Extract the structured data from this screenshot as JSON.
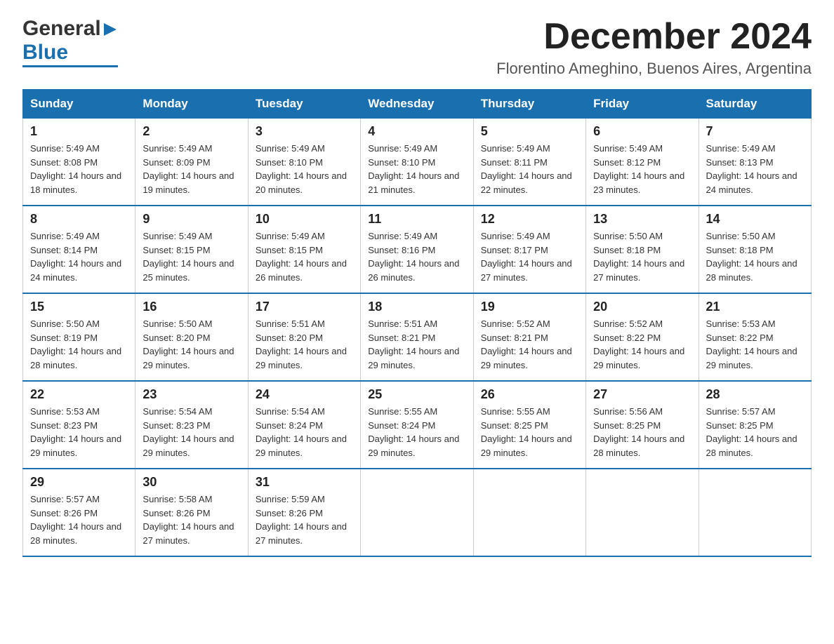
{
  "logo": {
    "general": "General",
    "blue": "Blue",
    "arrow_char": "▶"
  },
  "header": {
    "title": "December 2024",
    "subtitle": "Florentino Ameghino, Buenos Aires, Argentina"
  },
  "weekdays": [
    "Sunday",
    "Monday",
    "Tuesday",
    "Wednesday",
    "Thursday",
    "Friday",
    "Saturday"
  ],
  "weeks": [
    [
      {
        "day": "1",
        "sunrise": "Sunrise: 5:49 AM",
        "sunset": "Sunset: 8:08 PM",
        "daylight": "Daylight: 14 hours and 18 minutes."
      },
      {
        "day": "2",
        "sunrise": "Sunrise: 5:49 AM",
        "sunset": "Sunset: 8:09 PM",
        "daylight": "Daylight: 14 hours and 19 minutes."
      },
      {
        "day": "3",
        "sunrise": "Sunrise: 5:49 AM",
        "sunset": "Sunset: 8:10 PM",
        "daylight": "Daylight: 14 hours and 20 minutes."
      },
      {
        "day": "4",
        "sunrise": "Sunrise: 5:49 AM",
        "sunset": "Sunset: 8:10 PM",
        "daylight": "Daylight: 14 hours and 21 minutes."
      },
      {
        "day": "5",
        "sunrise": "Sunrise: 5:49 AM",
        "sunset": "Sunset: 8:11 PM",
        "daylight": "Daylight: 14 hours and 22 minutes."
      },
      {
        "day": "6",
        "sunrise": "Sunrise: 5:49 AM",
        "sunset": "Sunset: 8:12 PM",
        "daylight": "Daylight: 14 hours and 23 minutes."
      },
      {
        "day": "7",
        "sunrise": "Sunrise: 5:49 AM",
        "sunset": "Sunset: 8:13 PM",
        "daylight": "Daylight: 14 hours and 24 minutes."
      }
    ],
    [
      {
        "day": "8",
        "sunrise": "Sunrise: 5:49 AM",
        "sunset": "Sunset: 8:14 PM",
        "daylight": "Daylight: 14 hours and 24 minutes."
      },
      {
        "day": "9",
        "sunrise": "Sunrise: 5:49 AM",
        "sunset": "Sunset: 8:15 PM",
        "daylight": "Daylight: 14 hours and 25 minutes."
      },
      {
        "day": "10",
        "sunrise": "Sunrise: 5:49 AM",
        "sunset": "Sunset: 8:15 PM",
        "daylight": "Daylight: 14 hours and 26 minutes."
      },
      {
        "day": "11",
        "sunrise": "Sunrise: 5:49 AM",
        "sunset": "Sunset: 8:16 PM",
        "daylight": "Daylight: 14 hours and 26 minutes."
      },
      {
        "day": "12",
        "sunrise": "Sunrise: 5:49 AM",
        "sunset": "Sunset: 8:17 PM",
        "daylight": "Daylight: 14 hours and 27 minutes."
      },
      {
        "day": "13",
        "sunrise": "Sunrise: 5:50 AM",
        "sunset": "Sunset: 8:18 PM",
        "daylight": "Daylight: 14 hours and 27 minutes."
      },
      {
        "day": "14",
        "sunrise": "Sunrise: 5:50 AM",
        "sunset": "Sunset: 8:18 PM",
        "daylight": "Daylight: 14 hours and 28 minutes."
      }
    ],
    [
      {
        "day": "15",
        "sunrise": "Sunrise: 5:50 AM",
        "sunset": "Sunset: 8:19 PM",
        "daylight": "Daylight: 14 hours and 28 minutes."
      },
      {
        "day": "16",
        "sunrise": "Sunrise: 5:50 AM",
        "sunset": "Sunset: 8:20 PM",
        "daylight": "Daylight: 14 hours and 29 minutes."
      },
      {
        "day": "17",
        "sunrise": "Sunrise: 5:51 AM",
        "sunset": "Sunset: 8:20 PM",
        "daylight": "Daylight: 14 hours and 29 minutes."
      },
      {
        "day": "18",
        "sunrise": "Sunrise: 5:51 AM",
        "sunset": "Sunset: 8:21 PM",
        "daylight": "Daylight: 14 hours and 29 minutes."
      },
      {
        "day": "19",
        "sunrise": "Sunrise: 5:52 AM",
        "sunset": "Sunset: 8:21 PM",
        "daylight": "Daylight: 14 hours and 29 minutes."
      },
      {
        "day": "20",
        "sunrise": "Sunrise: 5:52 AM",
        "sunset": "Sunset: 8:22 PM",
        "daylight": "Daylight: 14 hours and 29 minutes."
      },
      {
        "day": "21",
        "sunrise": "Sunrise: 5:53 AM",
        "sunset": "Sunset: 8:22 PM",
        "daylight": "Daylight: 14 hours and 29 minutes."
      }
    ],
    [
      {
        "day": "22",
        "sunrise": "Sunrise: 5:53 AM",
        "sunset": "Sunset: 8:23 PM",
        "daylight": "Daylight: 14 hours and 29 minutes."
      },
      {
        "day": "23",
        "sunrise": "Sunrise: 5:54 AM",
        "sunset": "Sunset: 8:23 PM",
        "daylight": "Daylight: 14 hours and 29 minutes."
      },
      {
        "day": "24",
        "sunrise": "Sunrise: 5:54 AM",
        "sunset": "Sunset: 8:24 PM",
        "daylight": "Daylight: 14 hours and 29 minutes."
      },
      {
        "day": "25",
        "sunrise": "Sunrise: 5:55 AM",
        "sunset": "Sunset: 8:24 PM",
        "daylight": "Daylight: 14 hours and 29 minutes."
      },
      {
        "day": "26",
        "sunrise": "Sunrise: 5:55 AM",
        "sunset": "Sunset: 8:25 PM",
        "daylight": "Daylight: 14 hours and 29 minutes."
      },
      {
        "day": "27",
        "sunrise": "Sunrise: 5:56 AM",
        "sunset": "Sunset: 8:25 PM",
        "daylight": "Daylight: 14 hours and 28 minutes."
      },
      {
        "day": "28",
        "sunrise": "Sunrise: 5:57 AM",
        "sunset": "Sunset: 8:25 PM",
        "daylight": "Daylight: 14 hours and 28 minutes."
      }
    ],
    [
      {
        "day": "29",
        "sunrise": "Sunrise: 5:57 AM",
        "sunset": "Sunset: 8:26 PM",
        "daylight": "Daylight: 14 hours and 28 minutes."
      },
      {
        "day": "30",
        "sunrise": "Sunrise: 5:58 AM",
        "sunset": "Sunset: 8:26 PM",
        "daylight": "Daylight: 14 hours and 27 minutes."
      },
      {
        "day": "31",
        "sunrise": "Sunrise: 5:59 AM",
        "sunset": "Sunset: 8:26 PM",
        "daylight": "Daylight: 14 hours and 27 minutes."
      },
      null,
      null,
      null,
      null
    ]
  ]
}
